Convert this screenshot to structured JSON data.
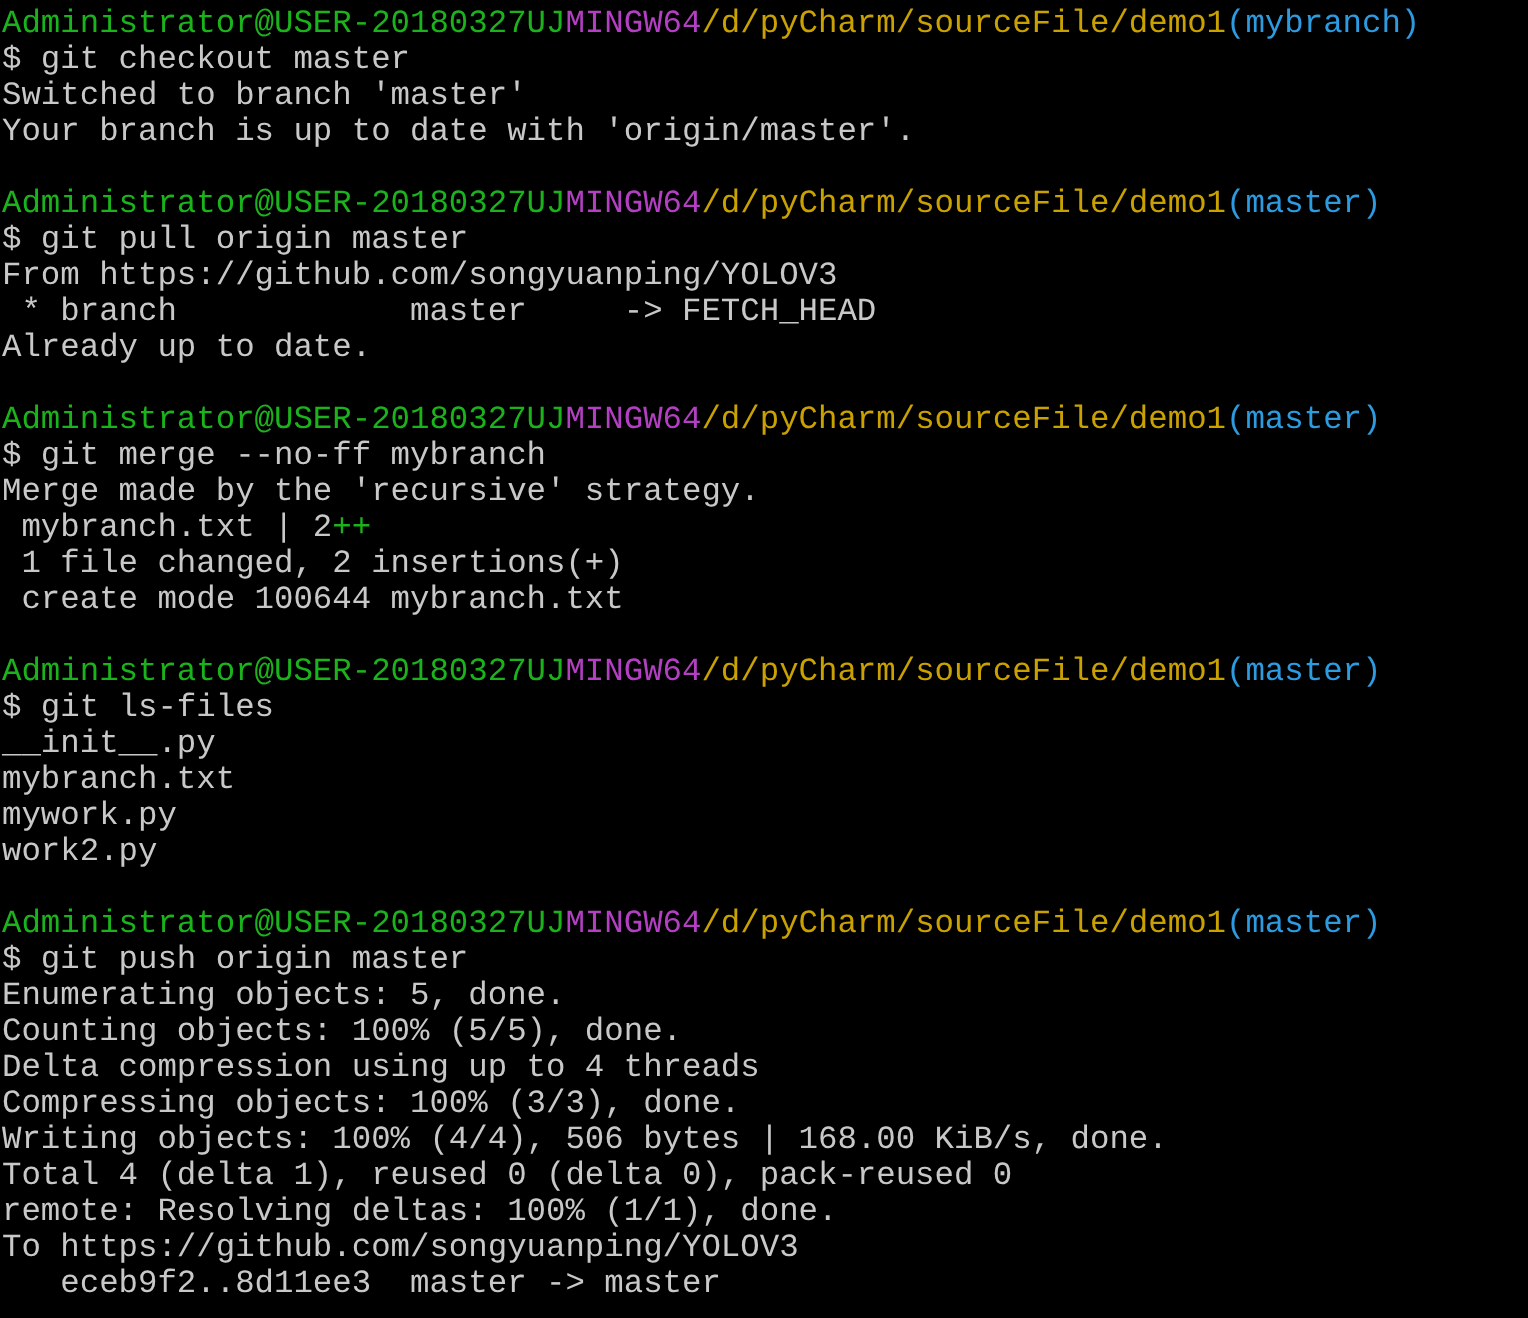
{
  "sessions": [
    {
      "prompt": {
        "user_host": "Administrator@USER-20180327UJ",
        "shell": "MINGW64",
        "path": "/d/pyCharm/sourceFile/demo1",
        "branch": "(mybranch)"
      },
      "command": "$ git checkout master",
      "output": [
        {
          "kind": "text",
          "text": "Switched to branch 'master'"
        },
        {
          "kind": "text",
          "text": "Your branch is up to date with 'origin/master'."
        }
      ]
    },
    {
      "prompt": {
        "user_host": "Administrator@USER-20180327UJ",
        "shell": "MINGW64",
        "path": "/d/pyCharm/sourceFile/demo1",
        "branch": "(master)"
      },
      "command": "$ git pull origin master",
      "output": [
        {
          "kind": "text",
          "text": "From https://github.com/songyuanping/YOLOV3"
        },
        {
          "kind": "text",
          "text": " * branch            master     -> FETCH_HEAD"
        },
        {
          "kind": "text",
          "text": "Already up to date."
        }
      ]
    },
    {
      "prompt": {
        "user_host": "Administrator@USER-20180327UJ",
        "shell": "MINGW64",
        "path": "/d/pyCharm/sourceFile/demo1",
        "branch": "(master)"
      },
      "command": "$ git merge --no-ff mybranch",
      "output": [
        {
          "kind": "text",
          "text": "Merge made by the 'recursive' strategy."
        },
        {
          "kind": "diffstat",
          "text": " mybranch.txt | 2",
          "graph": "++"
        },
        {
          "kind": "text",
          "text": " 1 file changed, 2 insertions(+)"
        },
        {
          "kind": "text",
          "text": " create mode 100644 mybranch.txt"
        }
      ]
    },
    {
      "prompt": {
        "user_host": "Administrator@USER-20180327UJ",
        "shell": "MINGW64",
        "path": "/d/pyCharm/sourceFile/demo1",
        "branch": "(master)"
      },
      "command": "$ git ls-files",
      "output": [
        {
          "kind": "text",
          "text": "__init__.py"
        },
        {
          "kind": "text",
          "text": "mybranch.txt"
        },
        {
          "kind": "text",
          "text": "mywork.py"
        },
        {
          "kind": "text",
          "text": "work2.py"
        }
      ]
    },
    {
      "prompt": {
        "user_host": "Administrator@USER-20180327UJ",
        "shell": "MINGW64",
        "path": "/d/pyCharm/sourceFile/demo1",
        "branch": "(master)"
      },
      "command": "$ git push origin master",
      "output": [
        {
          "kind": "text",
          "text": "Enumerating objects: 5, done."
        },
        {
          "kind": "text",
          "text": "Counting objects: 100% (5/5), done."
        },
        {
          "kind": "text",
          "text": "Delta compression using up to 4 threads"
        },
        {
          "kind": "text",
          "text": "Compressing objects: 100% (3/3), done."
        },
        {
          "kind": "text",
          "text": "Writing objects: 100% (4/4), 506 bytes | 168.00 KiB/s, done."
        },
        {
          "kind": "text",
          "text": "Total 4 (delta 1), reused 0 (delta 0), pack-reused 0"
        },
        {
          "kind": "text",
          "text": "remote: Resolving deltas: 100% (1/1), done."
        },
        {
          "kind": "text",
          "text": "To https://github.com/songyuanping/YOLOV3"
        },
        {
          "kind": "text",
          "text": "   eceb9f2..8d11ee3  master -> master"
        }
      ]
    }
  ]
}
